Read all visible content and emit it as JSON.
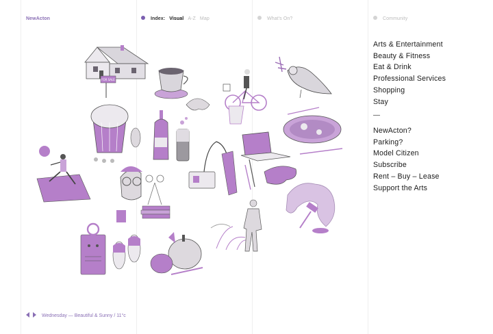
{
  "brand": "NewActon",
  "nav": {
    "index_label": "Index:",
    "visual": "Visual",
    "az": "A-Z",
    "map": "Map",
    "whats_on": "What's On?",
    "community": "Community"
  },
  "categories": [
    "Arts & Entertainment",
    "Beauty & Fitness",
    "Eat & Drink",
    "Professional Services",
    "Shopping",
    "Stay"
  ],
  "separator": "—",
  "links": [
    "NewActon?",
    "Parking?",
    "Model Citizen",
    "Subscribe",
    "Rent – Buy – Lease",
    "Support the Arts"
  ],
  "weather": {
    "text": "Wednesday — Beautiful & Sunny / 11°c"
  },
  "house_sign": "FOR SALE",
  "colors": {
    "accent": "#8a6fb5",
    "purple": "#b57fc9",
    "grey": "#c9c6cc",
    "dot_active": "#7b5fb0",
    "dot_inactive": "#d4d4d4"
  }
}
